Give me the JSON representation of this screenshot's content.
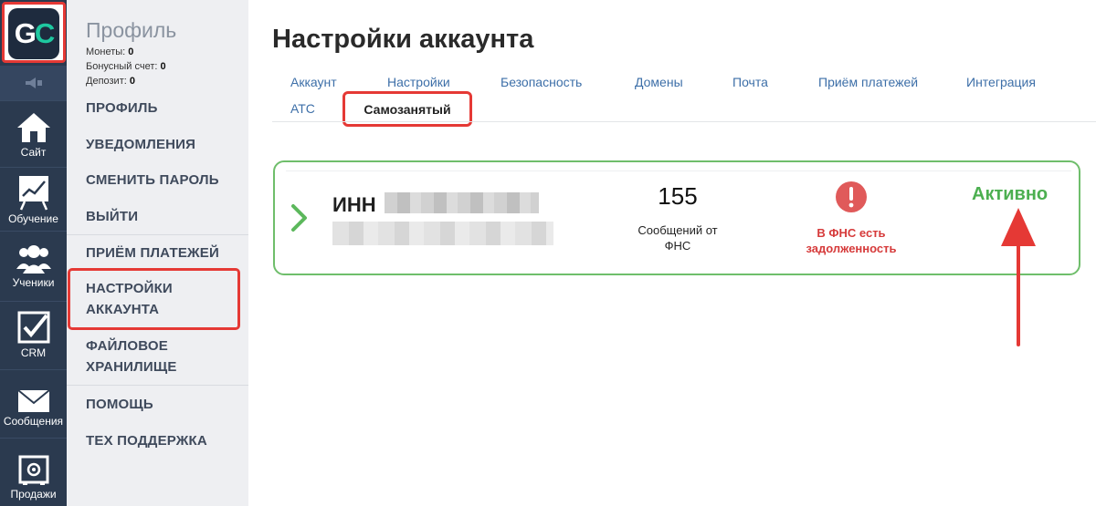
{
  "logo": {
    "text_g": "G",
    "text_c": "C",
    "brand_color": "#1ec8a0"
  },
  "rail": {
    "items": [
      {
        "label": "Сайт",
        "icon": "house-icon"
      },
      {
        "label": "Обучение",
        "icon": "chart-board-icon"
      },
      {
        "label": "Ученики",
        "icon": "users-icon"
      },
      {
        "label": "CRM",
        "icon": "checkbox-icon"
      },
      {
        "label": "Сообщения",
        "icon": "envelope-icon"
      },
      {
        "label": "Продажи",
        "icon": "safe-icon"
      }
    ]
  },
  "profile": {
    "title": "Профиль",
    "coins_label": "Монеты:",
    "coins_value": "0",
    "bonus_label": "Бонусный счет:",
    "bonus_value": "0",
    "deposit_label": "Депозит:",
    "deposit_value": "0",
    "menu": [
      "ПРОФИЛЬ",
      "УВЕДОМЛЕНИЯ",
      "СМЕНИТЬ ПАРОЛЬ",
      "ВЫЙТИ",
      "ПРИЁМ ПЛАТЕЖЕЙ",
      "НАСТРОЙКИ\nАККАУНТА",
      "ФАЙЛОВОЕ\nХРАНИЛИЩЕ",
      "ПОМОЩЬ",
      "ТЕХ ПОДДЕРЖКА"
    ]
  },
  "main": {
    "title": "Настройки аккаунта",
    "tabs": [
      "Аккаунт",
      "Настройки",
      "Безопасность",
      "Домены",
      "Почта",
      "Приём платежей",
      "Интеграция",
      "АТС",
      "Самозанятый"
    ],
    "active_tab": "Самозанятый"
  },
  "card": {
    "inn_label": "ИНН",
    "messages_count": "155",
    "messages_label": "Сообщений от ФНС",
    "debt_text": "В ФНС есть задолженность",
    "status": "Активно",
    "colors": {
      "border": "#6fbe6b",
      "status": "#4caf50",
      "warning": "#e05a5a",
      "highlight": "#e53935"
    }
  }
}
